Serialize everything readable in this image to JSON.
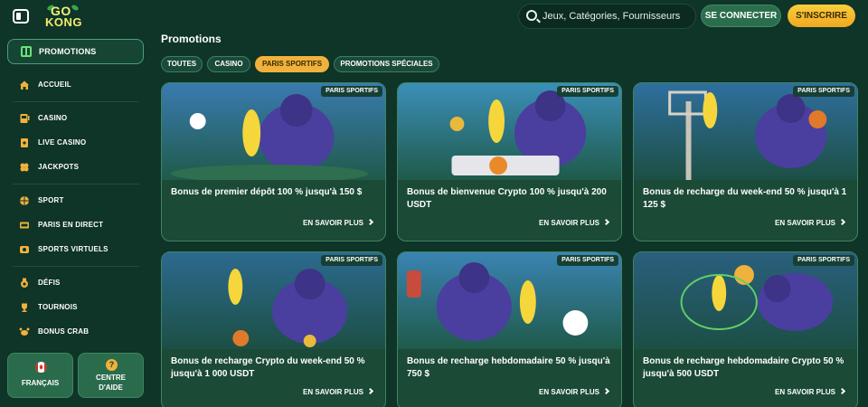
{
  "header": {
    "logo_top": "GO",
    "logo_bottom": "KONG",
    "search_placeholder": "Jeux, Catégories, Fournisseurs",
    "login_label": "SE CONNECTER",
    "signup_label": "S'INSCRIRE"
  },
  "sidebar": {
    "promotions_label": "PROMOTIONS",
    "items": [
      {
        "label": "ACCUEIL",
        "icon": "home-icon"
      },
      {
        "label": "CASINO",
        "icon": "slot-machine-icon"
      },
      {
        "label": "LIVE CASINO",
        "icon": "live-card-icon"
      },
      {
        "label": "JACKPOTS",
        "icon": "clover-icon"
      },
      {
        "label": "SPORT",
        "icon": "basketball-icon"
      },
      {
        "label": "PARIS EN DIRECT",
        "icon": "live-tv-icon"
      },
      {
        "label": "SPORTS VIRTUELS",
        "icon": "virtual-sports-icon"
      },
      {
        "label": "DÉFIS",
        "icon": "medal-icon"
      },
      {
        "label": "TOURNOIS",
        "icon": "trophy-icon"
      },
      {
        "label": "BONUS CRAB",
        "icon": "crab-icon"
      }
    ],
    "language_label": "FRANÇAIS",
    "help_label_line1": "CENTRE",
    "help_label_line2": "D'AIDE",
    "help_icon_glyph": "?"
  },
  "main": {
    "title": "Promotions",
    "tabs": [
      {
        "label": "TOUTES",
        "active": false
      },
      {
        "label": "CASINO",
        "active": false
      },
      {
        "label": "PARIS SPORTIFS",
        "active": true
      },
      {
        "label": "PROMOTIONS SPÉCIALES",
        "active": false
      }
    ],
    "cards": [
      {
        "badge": "PARIS SPORTIFS",
        "title": "Bonus de premier dépôt 100 % jusqu'à 150 $",
        "cta": "EN SAVOIR PLUS"
      },
      {
        "badge": "PARIS SPORTIFS",
        "title": "Bonus de bienvenue Crypto 100 % jusqu'à 200 USDT",
        "cta": "EN SAVOIR PLUS"
      },
      {
        "badge": "PARIS SPORTIFS",
        "title": "Bonus de recharge du week-end 50 % jusqu'à 1 125 $",
        "cta": "EN SAVOIR PLUS"
      },
      {
        "badge": "PARIS SPORTIFS",
        "title": "Bonus de recharge Crypto du week-end 50 % jusqu'à 1 000 USDT",
        "cta": "EN SAVOIR PLUS"
      },
      {
        "badge": "PARIS SPORTIFS",
        "title": "Bonus de recharge hebdomadaire 50 % jusqu'à 750 $",
        "cta": "EN SAVOIR PLUS"
      },
      {
        "badge": "PARIS SPORTIFS",
        "title": "Bonus de recharge hebdomadaire Crypto 50 % jusqu'à 500 USDT",
        "cta": "EN SAVOIR PLUS"
      }
    ]
  },
  "colors": {
    "background": "#0f3428",
    "card": "#1b4a37",
    "accent_green": "#2b6e4e",
    "accent_yellow": "#f0b23c"
  }
}
